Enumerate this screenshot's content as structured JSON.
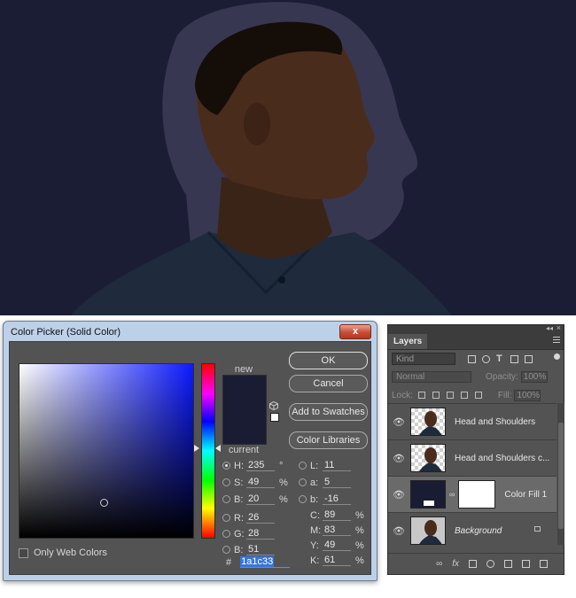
{
  "color_picker": {
    "title": "Color Picker (Solid Color)",
    "close_label": "x",
    "new_label": "new",
    "current_label": "current",
    "new_color": "#1a1c33",
    "current_color": "#1a1c33",
    "buttons": {
      "ok": "OK",
      "cancel": "Cancel",
      "add_to_swatches": "Add to Swatches",
      "color_libraries": "Color Libraries"
    },
    "only_web_colors_label": "Only Web Colors",
    "fields": {
      "H": {
        "label": "H:",
        "value": "235",
        "unit": "°"
      },
      "S": {
        "label": "S:",
        "value": "49",
        "unit": "%"
      },
      "Bv": {
        "label": "B:",
        "value": "20",
        "unit": "%"
      },
      "R": {
        "label": "R:",
        "value": "26"
      },
      "G": {
        "label": "G:",
        "value": "28"
      },
      "B": {
        "label": "B:",
        "value": "51"
      },
      "L": {
        "label": "L:",
        "value": "11"
      },
      "a": {
        "label": "a:",
        "value": "5"
      },
      "b": {
        "label": "b:",
        "value": "-16"
      },
      "C": {
        "label": "C:",
        "value": "89",
        "unit": "%"
      },
      "M": {
        "label": "M:",
        "value": "83",
        "unit": "%"
      },
      "Y": {
        "label": "Y:",
        "value": "49",
        "unit": "%"
      },
      "K": {
        "label": "K:",
        "value": "61",
        "unit": "%"
      }
    },
    "hex_label": "#",
    "hex_value": "1a1c33"
  },
  "layers_panel": {
    "tab_label": "Layers",
    "filter_placeholder": "Kind",
    "blend_mode": "Normal",
    "opacity_label": "Opacity:",
    "opacity_value": "100%",
    "lock_label": "Lock:",
    "fill_label": "Fill:",
    "fill_value": "100%",
    "layers": [
      {
        "name": "Head and Shoulders"
      },
      {
        "name": "Head and Shoulders c..."
      },
      {
        "name": "Color Fill 1"
      },
      {
        "name": "Background"
      }
    ]
  }
}
